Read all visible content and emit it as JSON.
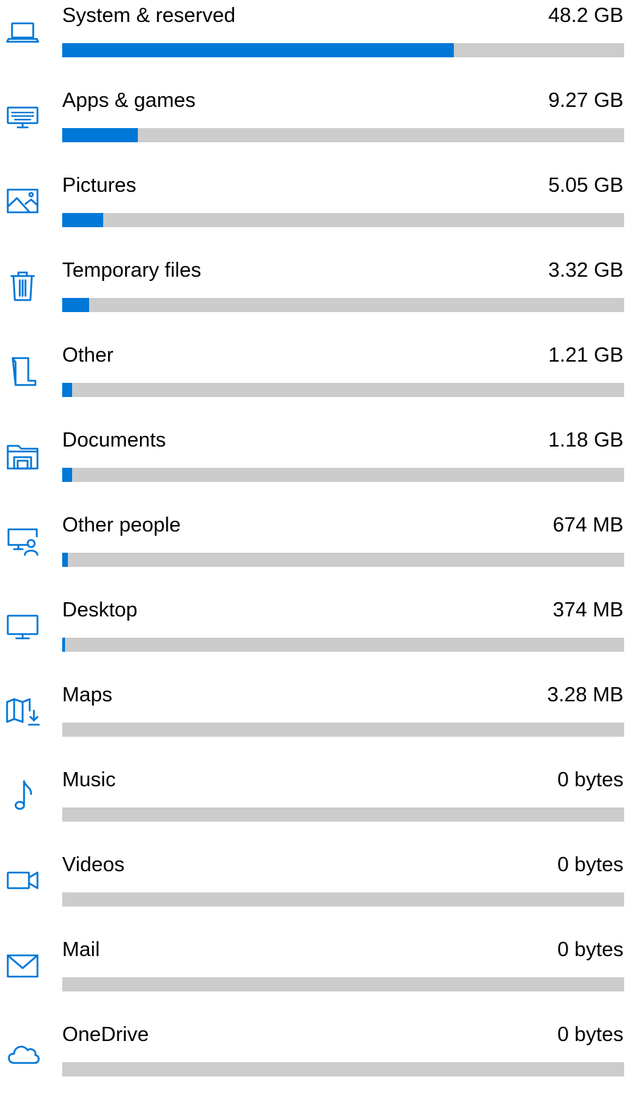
{
  "accent_color": "#0078d7",
  "track_color": "#cccccc",
  "categories": [
    {
      "label": "System & reserved",
      "size": "48.2 GB",
      "fill_fraction": 0.697,
      "icon": "laptop-icon"
    },
    {
      "label": "Apps & games",
      "size": "9.27 GB",
      "fill_fraction": 0.134,
      "icon": "keyboard-monitor-icon"
    },
    {
      "label": "Pictures",
      "size": "5.05 GB",
      "fill_fraction": 0.073,
      "icon": "picture-icon"
    },
    {
      "label": "Temporary files",
      "size": "3.32 GB",
      "fill_fraction": 0.048,
      "icon": "trash-icon"
    },
    {
      "label": "Other",
      "size": "1.21 GB",
      "fill_fraction": 0.018,
      "icon": "folded-page-icon"
    },
    {
      "label": "Documents",
      "size": "1.18 GB",
      "fill_fraction": 0.017,
      "icon": "documents-folder-icon"
    },
    {
      "label": "Other people",
      "size": "674 MB",
      "fill_fraction": 0.01,
      "icon": "monitor-person-icon"
    },
    {
      "label": "Desktop",
      "size": "374 MB",
      "fill_fraction": 0.005,
      "icon": "desktop-monitor-icon"
    },
    {
      "label": "Maps",
      "size": "3.28 MB",
      "fill_fraction": 0,
      "icon": "map-download-icon"
    },
    {
      "label": "Music",
      "size": "0 bytes",
      "fill_fraction": 0,
      "icon": "music-note-icon"
    },
    {
      "label": "Videos",
      "size": "0 bytes",
      "fill_fraction": 0,
      "icon": "video-camera-icon"
    },
    {
      "label": "Mail",
      "size": "0 bytes",
      "fill_fraction": 0,
      "icon": "mail-envelope-icon"
    },
    {
      "label": "OneDrive",
      "size": "0 bytes",
      "fill_fraction": 0,
      "icon": "cloud-icon"
    }
  ]
}
